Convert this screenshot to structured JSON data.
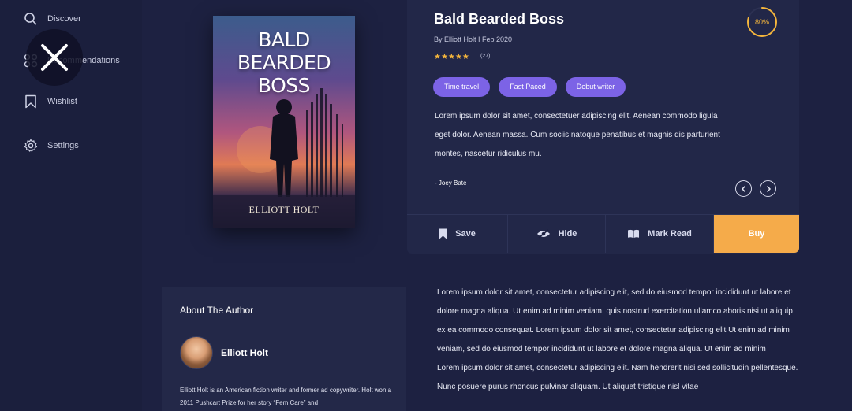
{
  "sidebar": {
    "items": [
      {
        "label": "Discover",
        "icon": "search-icon"
      },
      {
        "label": "Recommendations",
        "icon": "grid-icon"
      },
      {
        "label": "Wishlist",
        "icon": "bookmark-icon"
      },
      {
        "label": "Settings",
        "icon": "gear-icon"
      }
    ]
  },
  "overlay": {
    "icon": "close-icon"
  },
  "cover": {
    "title": "BALD BEARDED BOSS",
    "author": "ELLIOTT HOLT"
  },
  "book": {
    "title": "Bald Bearded Boss",
    "byline": "By Elliott Holt  I  Feb 2020",
    "rating": 5,
    "stars": "★★★★★",
    "review_count": "(27)",
    "progress_label": "80%",
    "progress_value": 0.8,
    "tags": [
      "Time travel",
      "Fast Paced",
      "Debut writer"
    ],
    "description": "Lorem ipsum dolor sit amet, consectetuer adipiscing elit. Aenean commodo ligula eget dolor. Aenean massa. Cum sociis natoque penatibus et magnis dis parturient montes, nascetur ridiculus mu.",
    "reviewer": "- Joey Bate"
  },
  "actions": {
    "save": "Save",
    "hide": "Hide",
    "mark_read": "Mark Read",
    "buy": "Buy"
  },
  "author": {
    "heading": "About The Author",
    "name": "Elliott Holt",
    "bio": "Elliott Holt is an American fiction writer and former ad copywriter. Holt won a 2011 Pushcart Prize for her story “Fem Care” and"
  },
  "body": {
    "paragraph1": "Lorem ipsum dolor sit amet, consectetur adipiscing elit, sed do eiusmod tempor incididunt ut labore et dolore magna aliqua. Ut enim ad minim veniam, quis nostrud exercitation ullamco aboris nisi ut aliquip ex ea commodo consequat. Lorem ipsum dolor sit amet, consectetur adipiscing elit Ut enim ad minim veniam, sed do eiusmod tempor incididunt ut labore et dolore magna aliqua. Ut enim ad minim",
    "paragraph2": "Lorem ipsum dolor sit amet, consectetur adipiscing elit. Nam hendrerit nisi sed sollicitudin pellentesque. Nunc posuere purus rhoncus pulvinar aliquam. Ut aliquet tristique nisl vitae"
  },
  "colors": {
    "background": "#1d2141",
    "card": "#222748",
    "tag": "#7c63e6",
    "accent": "#f5ab4a",
    "star": "#f5b63c"
  }
}
